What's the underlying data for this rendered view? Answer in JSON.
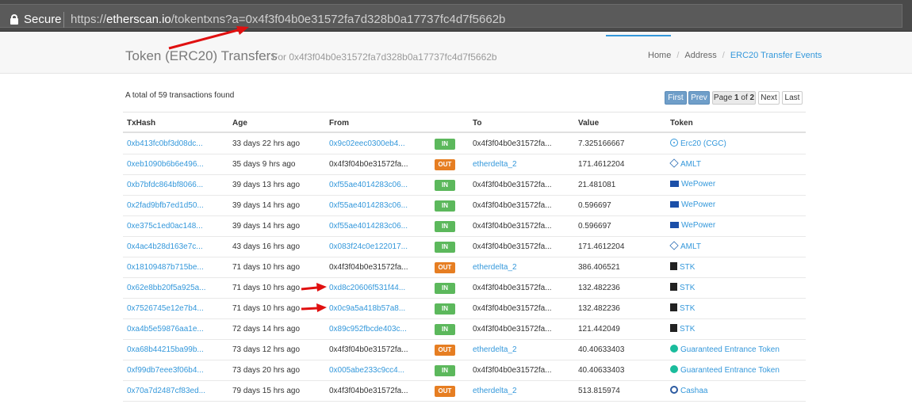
{
  "browser": {
    "secure_label": "Secure",
    "url_scheme": "https://",
    "url_host": "etherscan.io",
    "url_path": "/tokentxns?a=0x4f3f04b0e31572fa7d328b0a17737fc4d7f5662b"
  },
  "header": {
    "title": "Token (ERC20) Transfers",
    "subtitle": ":: For 0x4f3f04b0e31572fa7d328b0a17737fc4d7f5662b",
    "breadcrumb": [
      "Home",
      "Address",
      "ERC20 Transfer Events"
    ]
  },
  "summary": "A total of 59 transactions found",
  "pager": {
    "first": "First",
    "prev": "Prev",
    "page_prefix": "Page",
    "page_current": "1",
    "page_of": "of",
    "page_total": "2",
    "next": "Next",
    "last": "Last"
  },
  "table": {
    "columns": [
      "TxHash",
      "Age",
      "From",
      "",
      "To",
      "Value",
      "Token"
    ],
    "rows": [
      {
        "hash": "0xb413fc0bf3d08dc...",
        "age": "33 days 22 hrs ago",
        "from": "0x9c02eec0300eb4...",
        "from_link": true,
        "dir": "IN",
        "to": "0x4f3f04b0e31572fa...",
        "to_link": false,
        "value": "7.325166667",
        "token": "Erc20 (CGC)",
        "icon": "erc"
      },
      {
        "hash": "0xeb1090b6b6e496...",
        "age": "35 days 9 hrs ago",
        "from": "0x4f3f04b0e31572fa...",
        "from_link": false,
        "dir": "OUT",
        "to": "etherdelta_2",
        "to_link": true,
        "value": "171.4612204",
        "token": "AMLT",
        "icon": "amlt"
      },
      {
        "hash": "0xb7bfdc864bf8066...",
        "age": "39 days 13 hrs ago",
        "from": "0xf55ae4014283c06...",
        "from_link": true,
        "dir": "IN",
        "to": "0x4f3f04b0e31572fa...",
        "to_link": false,
        "value": "21.481081",
        "token": "WePower",
        "icon": "wpr"
      },
      {
        "hash": "0x2fad9bfb7ed1d50...",
        "age": "39 days 14 hrs ago",
        "from": "0xf55ae4014283c06...",
        "from_link": true,
        "dir": "IN",
        "to": "0x4f3f04b0e31572fa...",
        "to_link": false,
        "value": "0.596697",
        "token": "WePower",
        "icon": "wpr"
      },
      {
        "hash": "0xe375c1ed0ac148...",
        "age": "39 days 14 hrs ago",
        "from": "0xf55ae4014283c06...",
        "from_link": true,
        "dir": "IN",
        "to": "0x4f3f04b0e31572fa...",
        "to_link": false,
        "value": "0.596697",
        "token": "WePower",
        "icon": "wpr"
      },
      {
        "hash": "0x4ac4b28d163e7c...",
        "age": "43 days 16 hrs ago",
        "from": "0x083f24c0e122017...",
        "from_link": true,
        "dir": "IN",
        "to": "0x4f3f04b0e31572fa...",
        "to_link": false,
        "value": "171.4612204",
        "token": "AMLT",
        "icon": "amlt"
      },
      {
        "hash": "0x18109487b715be...",
        "age": "71 days 10 hrs ago",
        "from": "0x4f3f04b0e31572fa...",
        "from_link": false,
        "dir": "OUT",
        "to": "etherdelta_2",
        "to_link": true,
        "value": "386.406521",
        "token": "STK",
        "icon": "stk"
      },
      {
        "hash": "0x62e8bb20f5a925a...",
        "age": "71 days 10 hrs ago",
        "from": "0xd8c20606f531f44...",
        "from_link": true,
        "dir": "IN",
        "to": "0x4f3f04b0e31572fa...",
        "to_link": false,
        "value": "132.482236",
        "token": "STK",
        "icon": "stk"
      },
      {
        "hash": "0x7526745e12e7b4...",
        "age": "71 days 10 hrs ago",
        "from": "0x0c9a5a418b57a8...",
        "from_link": true,
        "dir": "IN",
        "to": "0x4f3f04b0e31572fa...",
        "to_link": false,
        "value": "132.482236",
        "token": "STK",
        "icon": "stk"
      },
      {
        "hash": "0xa4b5e59876aa1e...",
        "age": "72 days 14 hrs ago",
        "from": "0x89c952fbcde403c...",
        "from_link": true,
        "dir": "IN",
        "to": "0x4f3f04b0e31572fa...",
        "to_link": false,
        "value": "121.442049",
        "token": "STK",
        "icon": "stk"
      },
      {
        "hash": "0xa68b44215ba99b...",
        "age": "73 days 12 hrs ago",
        "from": "0x4f3f04b0e31572fa...",
        "from_link": false,
        "dir": "OUT",
        "to": "etherdelta_2",
        "to_link": true,
        "value": "40.40633403",
        "token": "Guaranteed Entrance Token",
        "icon": "get"
      },
      {
        "hash": "0xf99db7eee3f06b4...",
        "age": "73 days 20 hrs ago",
        "from": "0x005abe233c9cc4...",
        "from_link": true,
        "dir": "IN",
        "to": "0x4f3f04b0e31572fa...",
        "to_link": false,
        "value": "40.40633403",
        "token": "Guaranteed Entrance Token",
        "icon": "get"
      },
      {
        "hash": "0x70a7d2487cf83ed...",
        "age": "79 days 15 hrs ago",
        "from": "0x4f3f04b0e31572fa...",
        "from_link": false,
        "dir": "OUT",
        "to": "etherdelta_2",
        "to_link": true,
        "value": "513.815974",
        "token": "Cashaa",
        "icon": "cas"
      }
    ]
  },
  "colors": {
    "link": "#3498db",
    "in_badge": "#5cb85c",
    "out_badge": "#e67e22",
    "annotation": "#e01010"
  }
}
